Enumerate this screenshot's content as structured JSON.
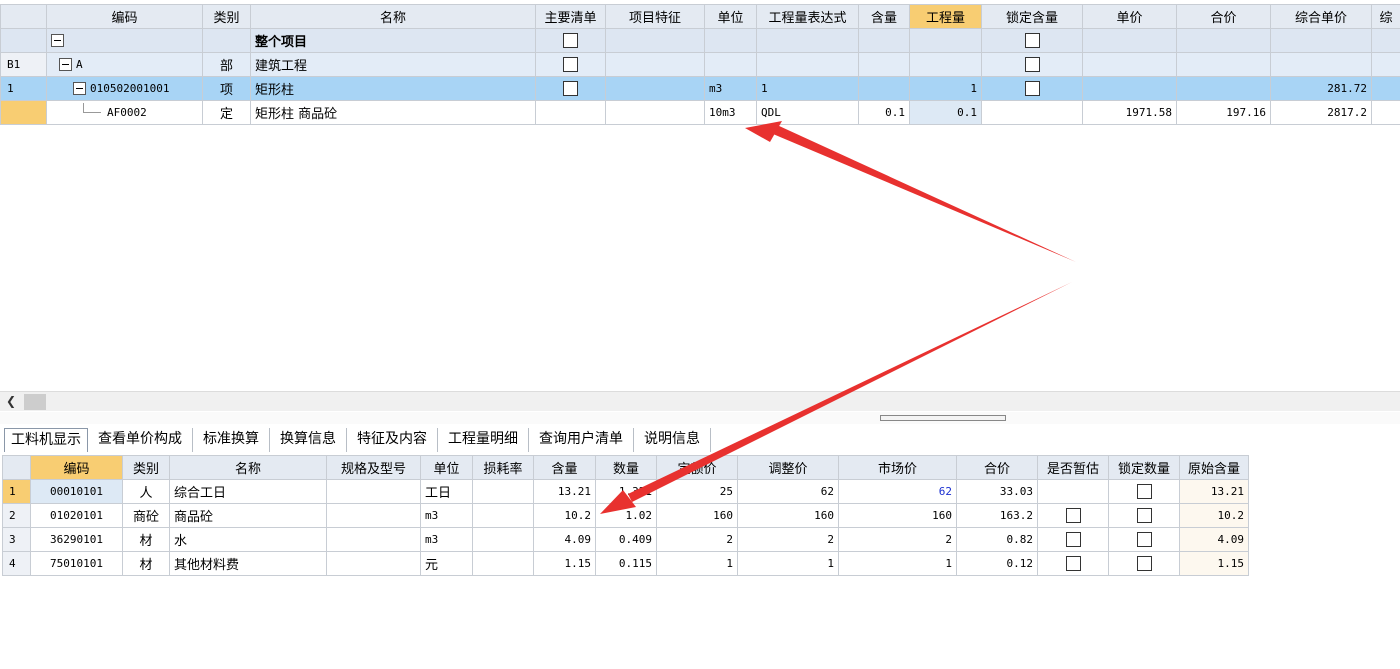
{
  "top_grid": {
    "headers": [
      "编码",
      "类别",
      "名称",
      "主要清单",
      "项目特征",
      "单位",
      "工程量表达式",
      "含量",
      "工程量",
      "锁定含量",
      "单价",
      "合价",
      "综合单价",
      "综"
    ],
    "rows": [
      {
        "row_no": "",
        "code": "",
        "type": "",
        "name": "整个项目",
        "unit": "",
        "expr": "",
        "content": "",
        "qty": "",
        "unit_price": "",
        "total": "",
        "comp_price": ""
      },
      {
        "row_no": "B1",
        "code": "A",
        "type": "部",
        "name": "建筑工程",
        "unit": "",
        "expr": "",
        "content": "",
        "qty": "",
        "unit_price": "",
        "total": "",
        "comp_price": ""
      },
      {
        "row_no": "1",
        "code": "010502001001",
        "type": "项",
        "name": "矩形柱",
        "unit": "m3",
        "expr": "1",
        "content": "",
        "qty": "1",
        "unit_price": "",
        "total": "",
        "comp_price": "281.72"
      },
      {
        "row_no": "",
        "code": "AF0002",
        "type": "定",
        "name": "矩形柱 商品砼",
        "unit": "10m3",
        "expr": "QDL",
        "content": "0.1",
        "qty": "0.1",
        "unit_price": "1971.58",
        "total": "197.16",
        "comp_price": "2817.2"
      }
    ]
  },
  "tabs": [
    "工料机显示",
    "查看单价构成",
    "标准换算",
    "换算信息",
    "特征及内容",
    "工程量明细",
    "查询用户清单",
    "说明信息"
  ],
  "bottom_grid": {
    "headers": [
      "编码",
      "类别",
      "名称",
      "规格及型号",
      "单位",
      "损耗率",
      "含量",
      "数量",
      "定额价",
      "调整价",
      "市场价",
      "合价",
      "是否暂估",
      "锁定数量",
      "原始含量"
    ],
    "rows": [
      {
        "row_no": "1",
        "code": "00010101",
        "type": "人",
        "name": "综合工日",
        "spec": "",
        "unit": "工日",
        "loss": "",
        "content": "13.21",
        "qty": "1.321",
        "quota_price": "25",
        "adj_price": "62",
        "market_price": "62",
        "total": "33.03",
        "orig": "13.21"
      },
      {
        "row_no": "2",
        "code": "01020101",
        "type": "商砼",
        "name": "商品砼",
        "spec": "",
        "unit": "m3",
        "loss": "",
        "content": "10.2",
        "qty": "1.02",
        "quota_price": "160",
        "adj_price": "160",
        "market_price": "160",
        "total": "163.2",
        "orig": "10.2"
      },
      {
        "row_no": "3",
        "code": "36290101",
        "type": "材",
        "name": "水",
        "spec": "",
        "unit": "m3",
        "loss": "",
        "content": "4.09",
        "qty": "0.409",
        "quota_price": "2",
        "adj_price": "2",
        "market_price": "2",
        "total": "0.82",
        "orig": "4.09"
      },
      {
        "row_no": "4",
        "code": "75010101",
        "type": "材",
        "name": "其他材料费",
        "spec": "",
        "unit": "元",
        "loss": "",
        "content": "1.15",
        "qty": "0.115",
        "quota_price": "1",
        "adj_price": "1",
        "market_price": "1",
        "total": "0.12",
        "orig": "1.15"
      }
    ]
  },
  "colors": {
    "header_bg": "#e4eaf2",
    "selected_header": "#f8cd72",
    "selected_row": "#a8d4f5",
    "arrow": "#e8312f",
    "highlight_value": "#1a2fd1"
  },
  "icons": {
    "tree_toggle": "minus-box-icon",
    "scroll_left": "chevron-left-icon",
    "checkbox": "checkbox-icon"
  }
}
